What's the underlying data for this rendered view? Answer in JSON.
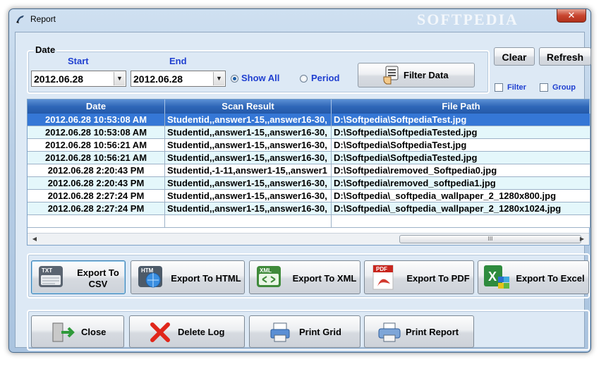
{
  "window": {
    "title": "Report",
    "watermark": "SOFTPEDIA",
    "close_label": "✕"
  },
  "date_group": {
    "legend": "Date",
    "start_label": "Start",
    "end_label": "End",
    "start_value": "2012.06.28",
    "end_value": "2012.06.28",
    "options": [
      {
        "label": "Show All",
        "selected": true
      },
      {
        "label": "Period",
        "selected": false
      }
    ]
  },
  "toolbar": {
    "filter_label": "Filter Data",
    "clear_label": "Clear",
    "refresh_label": "Refresh",
    "filter_check_label": "Filter",
    "group_check_label": "Group"
  },
  "grid": {
    "columns": [
      "Date",
      "Scan Result",
      "File Path"
    ],
    "rows": [
      {
        "date": "2012.06.28 10:53:08 AM",
        "scan": "Studentid,,answer1-15,,answer16-30,",
        "path": "D:\\Softpedia\\SoftpediaTest.jpg"
      },
      {
        "date": "2012.06.28 10:53:08 AM",
        "scan": "Studentid,,answer1-15,,answer16-30,",
        "path": "D:\\Softpedia\\SoftpediaTested.jpg"
      },
      {
        "date": "2012.06.28 10:56:21 AM",
        "scan": "Studentid,,answer1-15,,answer16-30,",
        "path": "D:\\Softpedia\\SoftpediaTest.jpg"
      },
      {
        "date": "2012.06.28 10:56:21 AM",
        "scan": "Studentid,,answer1-15,,answer16-30,",
        "path": "D:\\Softpedia\\SoftpediaTested.jpg"
      },
      {
        "date": "2012.06.28 2:20:43 PM",
        "scan": "Studentid,-1-11,answer1-15,,answer1",
        "path": "D:\\Softpedia\\removed_Softpedia0.jpg"
      },
      {
        "date": "2012.06.28 2:20:43 PM",
        "scan": "Studentid,,answer1-15,,answer16-30,",
        "path": "D:\\Softpedia\\removed_softpedia1.jpg"
      },
      {
        "date": "2012.06.28 2:27:24 PM",
        "scan": "Studentid,,answer1-15,,answer16-30,",
        "path": "D:\\Softpedia\\_softpedia_wallpaper_2_1280x800.jpg"
      },
      {
        "date": "2012.06.28 2:27:24 PM",
        "scan": "Studentid,,answer1-15,,answer16-30,",
        "path": "D:\\Softpedia\\_softpedia_wallpaper_2_1280x1024.jpg"
      }
    ],
    "scroll_thumb_grip": "III"
  },
  "export": {
    "csv": {
      "label_line1": "Export To",
      "label_line2": "CSV",
      "badge": "TXT"
    },
    "html": {
      "label": "Export To HTML",
      "badge": "HTM"
    },
    "xml": {
      "label": "Export To XML",
      "badge": "XML"
    },
    "pdf": {
      "label": "Export To PDF",
      "badge": "PDF"
    },
    "excel": {
      "label": "Export To Excel",
      "badge": "X"
    }
  },
  "actions": {
    "close_label": "Close",
    "delete_label": "Delete Log",
    "print_grid_label": "Print Grid",
    "print_report_label": "Print Report"
  },
  "colors": {
    "accent_blue": "#1f3fd0",
    "header_blue": "#2f67b8",
    "selected_row": "#3577d6"
  }
}
